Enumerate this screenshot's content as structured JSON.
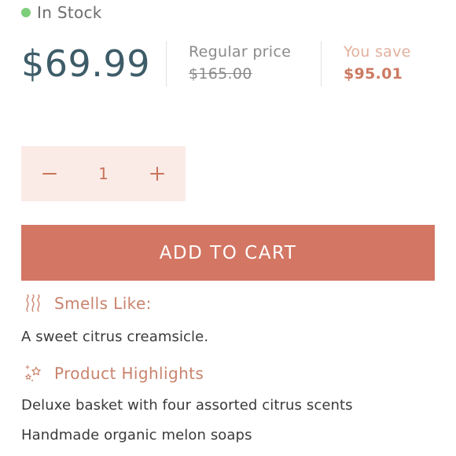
{
  "stock": {
    "status_text": "In Stock",
    "dot_color": "#7ccf7a"
  },
  "pricing": {
    "current_price": "$69.99",
    "regular_label": "Regular price",
    "regular_price": "$165.00",
    "save_label": "You save",
    "save_amount": "$95.01"
  },
  "quantity": {
    "decrement_icon": "minus-icon",
    "value": "1",
    "increment_icon": "plus-icon"
  },
  "cart": {
    "button_label": "ADD TO CART",
    "button_color": "#d37663"
  },
  "smells": {
    "icon": "scent-waves-icon",
    "title": "Smells Like:",
    "text": "A sweet citrus creamsicle."
  },
  "highlights": {
    "icon": "sparkle-stars-icon",
    "title": "Product Highlights",
    "items": [
      "Deluxe basket with four assorted citrus scents",
      "Handmade organic melon soaps"
    ]
  },
  "colors": {
    "accent": "#c9836d",
    "price": "#3d5c68",
    "stepper_bg": "#fbebe6"
  }
}
